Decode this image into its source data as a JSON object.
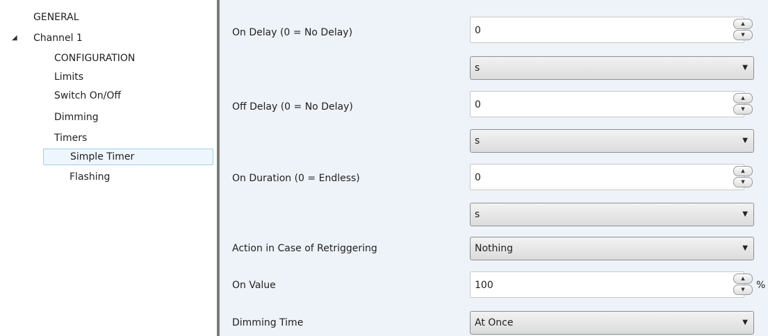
{
  "sidebar": {
    "items": [
      {
        "label": "GENERAL"
      },
      {
        "label": "Channel 1",
        "caret": "◢"
      },
      {
        "label": "CONFIGURATION"
      },
      {
        "label": "Limits"
      },
      {
        "label": "Switch On/Off"
      },
      {
        "label": "Dimming"
      },
      {
        "label": "Timers"
      },
      {
        "label": "Simple Timer"
      },
      {
        "label": "Flashing"
      }
    ]
  },
  "form": {
    "on_delay": {
      "label": "On Delay (0 = No Delay)",
      "value": "0",
      "unit_value": "s"
    },
    "off_delay": {
      "label": "Off Delay (0 = No Delay)",
      "value": "0",
      "unit_value": "s"
    },
    "on_duration": {
      "label": "On Duration (0 = Endless)",
      "value": "0",
      "unit_value": "s"
    },
    "retrigger": {
      "label": "Action in Case of Retriggering",
      "value": "Nothing"
    },
    "on_value": {
      "label": "On Value",
      "value": "100",
      "unit": "%"
    },
    "dimming_time": {
      "label": "Dimming Time",
      "value": "At Once"
    }
  },
  "icons": {
    "spin_up": "▲",
    "spin_down": "▼",
    "dropdown": "▼"
  }
}
